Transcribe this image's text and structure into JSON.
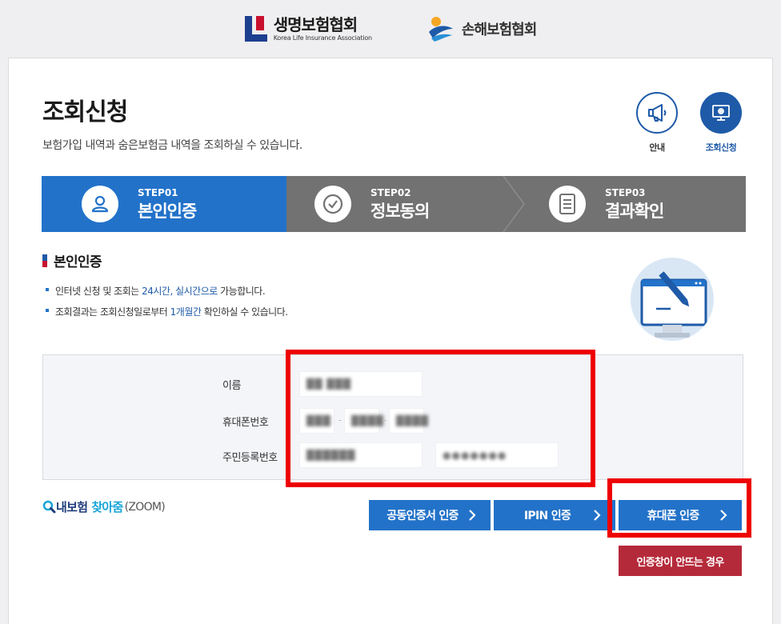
{
  "header": {
    "logo_klia_ko": "생명보험협회",
    "logo_klia_en": "Korea Life Insurance Association",
    "logo_gnia": "손해보험협회"
  },
  "page": {
    "title": "조회신청",
    "description": "보험가입 내역과 숨은보험금 내역을 조회하실 수 있습니다."
  },
  "quick_links": {
    "guide_label": "안내",
    "inquiry_label": "조회신청"
  },
  "steps": [
    {
      "num": "STEP01",
      "name": "본인인증",
      "icon": "user-icon"
    },
    {
      "num": "STEP02",
      "name": "정보동의",
      "icon": "check-circle-icon"
    },
    {
      "num": "STEP03",
      "name": "결과확인",
      "icon": "document-icon"
    }
  ],
  "section": {
    "title": "본인인증",
    "note1_a": "인터넷 신청 및 조회는 ",
    "note1_b": "24시간, 실시간으로",
    "note1_c": " 가능합니다.",
    "note2_a": "조회결과는 조회신청일로부터 ",
    "note2_b": "1개월간",
    "note2_c": " 확인하실 수 있습니다."
  },
  "form": {
    "name_label": "이름",
    "name_value": "██ ███",
    "phone_label": "휴대폰번호",
    "phone_1": "███",
    "phone_2": "████",
    "phone_3": "████",
    "rrn_label": "주민등록번호",
    "rrn_front": "██████",
    "rrn_back": "●●●●●●●"
  },
  "zoom": {
    "part1": "내보험",
    "part2": "찾아줌",
    "part3": "(ZOOM)"
  },
  "buttons": {
    "cert": "공동인증서 인증",
    "ipin": "IPIN 인증",
    "phone": "휴대폰 인증",
    "popup_fail": "인증창이 안뜨는 경우"
  },
  "colors": {
    "primary": "#2272c9",
    "step_inactive": "#727272",
    "warn": "#b52a3a",
    "highlight_box": "#ee0000"
  }
}
